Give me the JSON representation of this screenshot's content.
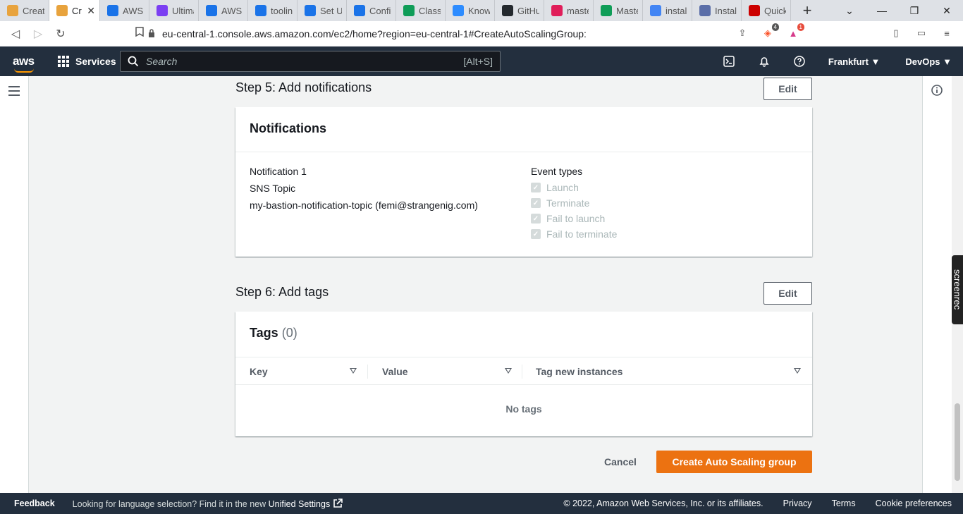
{
  "browser": {
    "tabs": [
      {
        "label": "Create",
        "icon": "aws-box-icon",
        "color": "#e8a33d"
      },
      {
        "label": "Cr",
        "icon": "aws-box-icon",
        "color": "#e8a33d",
        "active": true
      },
      {
        "label": "AWS S",
        "icon": "devops-icon",
        "color": "#1a73e8"
      },
      {
        "label": "Ultima",
        "icon": "u-icon",
        "color": "#7b3ff2"
      },
      {
        "label": "AWS C",
        "icon": "devops-icon",
        "color": "#1a73e8"
      },
      {
        "label": "tooling",
        "icon": "devops-icon",
        "color": "#1a73e8"
      },
      {
        "label": "Set Up",
        "icon": "devops-icon",
        "color": "#1a73e8"
      },
      {
        "label": "Config",
        "icon": "devops-icon",
        "color": "#1a73e8"
      },
      {
        "label": "Class",
        "icon": "sheets-icon",
        "color": "#0f9d58"
      },
      {
        "label": "Know",
        "icon": "zoom-icon",
        "color": "#2d8cff"
      },
      {
        "label": "GitHu",
        "icon": "github-icon",
        "color": "#24292e"
      },
      {
        "label": "maste",
        "icon": "slack-icon",
        "color": "#e01e5a"
      },
      {
        "label": "Maste",
        "icon": "sheets-icon",
        "color": "#0f9d58"
      },
      {
        "label": "install",
        "icon": "google-icon",
        "color": "#4285f4"
      },
      {
        "label": "Install",
        "icon": "ansible-icon",
        "color": "#5a6ea8"
      },
      {
        "label": "Quick",
        "icon": "redhat-icon",
        "color": "#cc0000"
      }
    ],
    "url": "eu-central-1.console.aws.amazon.com/ec2/home?region=eu-central-1#CreateAutoScalingGroup:",
    "brave_badge": "4",
    "alert_badge": "1"
  },
  "awsnav": {
    "logo": "aws",
    "services": "Services",
    "search_placeholder": "Search",
    "search_shortcut": "[Alt+S]",
    "region": "Frankfurt ▼",
    "user": "DevOps ▼"
  },
  "step5": {
    "heading": "Step 5: Add notifications",
    "edit": "Edit",
    "card_title": "Notifications",
    "notification_label": "Notification 1",
    "sns_label": "SNS Topic",
    "sns_value": "my-bastion-notification-topic (femi@strangenig.com)",
    "event_types_label": "Event types",
    "event_types": [
      "Launch",
      "Terminate",
      "Fail to launch",
      "Fail to terminate"
    ]
  },
  "step6": {
    "heading": "Step 6: Add tags",
    "edit": "Edit",
    "card_title": "Tags",
    "count": "(0)",
    "columns": [
      "Key",
      "Value",
      "Tag new instances"
    ],
    "empty": "No tags"
  },
  "actions": {
    "cancel": "Cancel",
    "create": "Create Auto Scaling group"
  },
  "side": {
    "screenrec": "screenrec"
  },
  "footer": {
    "feedback": "Feedback",
    "lang_text": "Looking for language selection? Find it in the new",
    "lang_link": "Unified Settings",
    "copyright": "© 2022, Amazon Web Services, Inc. or its affiliates.",
    "privacy": "Privacy",
    "terms": "Terms",
    "cookies": "Cookie preferences"
  }
}
